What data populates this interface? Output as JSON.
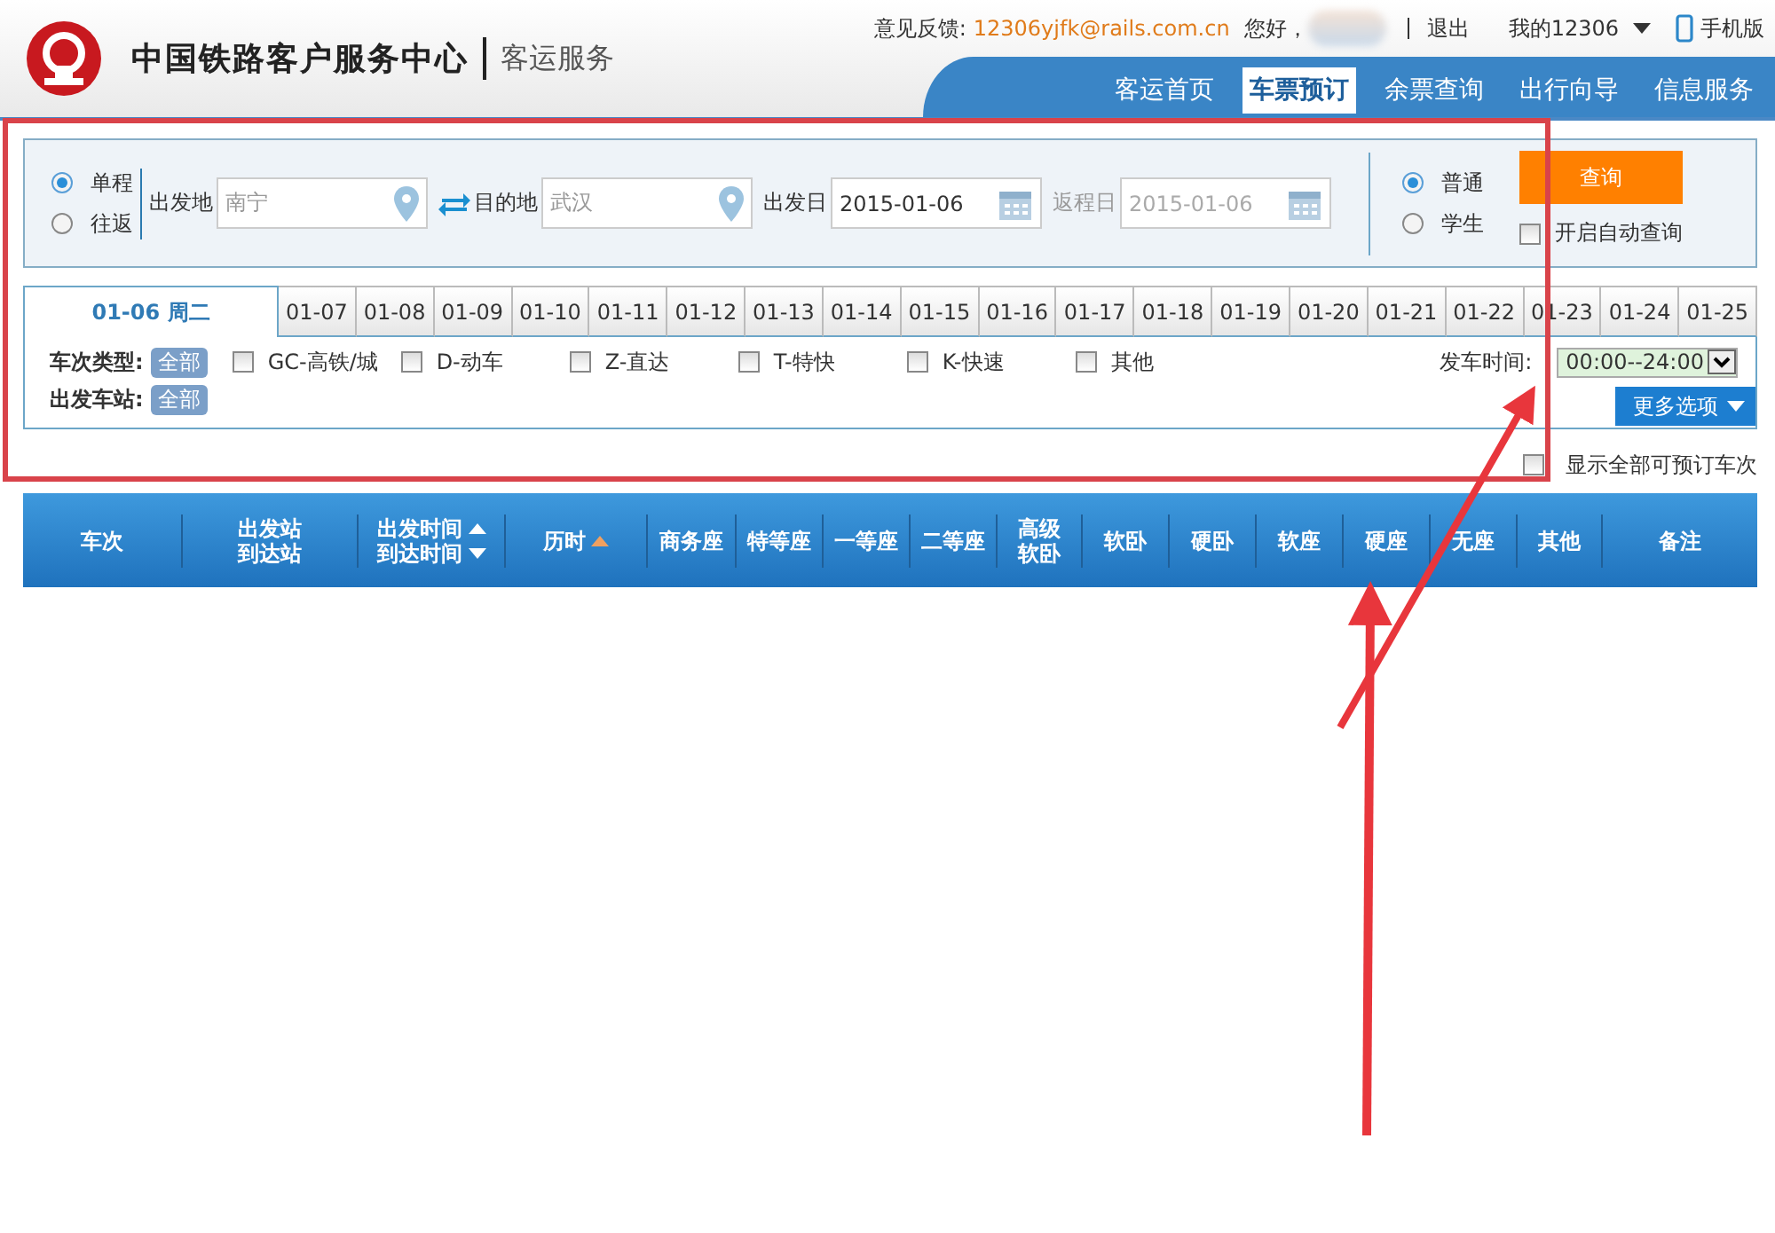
{
  "header": {
    "title": "中国铁路客户服务中心",
    "subtitle": "客运服务",
    "feedback_label": "意见反馈:",
    "feedback_email": "12306yjfk@rails.com.cn",
    "greeting": "您好，",
    "logout": "退出",
    "my_account": "我的12306",
    "mobile": "手机版"
  },
  "nav": [
    {
      "label": "客运首页",
      "selected": false
    },
    {
      "label": "车票预订",
      "selected": true
    },
    {
      "label": "余票查询",
      "selected": false
    },
    {
      "label": "出行向导",
      "selected": false
    },
    {
      "label": "信息服务",
      "selected": false
    }
  ],
  "search": {
    "trip_types": [
      {
        "label": "单程",
        "selected": true
      },
      {
        "label": "往返",
        "selected": false
      }
    ],
    "from": {
      "label": "出发地",
      "value": "南宁"
    },
    "to": {
      "label": "目的地",
      "value": "武汉"
    },
    "depart": {
      "label": "出发日",
      "value": "2015-01-06",
      "disabled": false
    },
    "return": {
      "label": "返程日",
      "value": "2015-01-06",
      "disabled": true
    },
    "passenger_types": [
      {
        "label": "普通",
        "selected": true
      },
      {
        "label": "学生",
        "selected": false
      }
    ],
    "query_button": "查询",
    "auto_query": {
      "label": "开启自动查询",
      "checked": false
    }
  },
  "dates": [
    {
      "label": "01-06 周二",
      "selected": true
    },
    {
      "label": "01-07",
      "selected": false
    },
    {
      "label": "01-08",
      "selected": false
    },
    {
      "label": "01-09",
      "selected": false
    },
    {
      "label": "01-10",
      "selected": false
    },
    {
      "label": "01-11",
      "selected": false
    },
    {
      "label": "01-12",
      "selected": false
    },
    {
      "label": "01-13",
      "selected": false
    },
    {
      "label": "01-14",
      "selected": false
    },
    {
      "label": "01-15",
      "selected": false
    },
    {
      "label": "01-16",
      "selected": false
    },
    {
      "label": "01-17",
      "selected": false
    },
    {
      "label": "01-18",
      "selected": false
    },
    {
      "label": "01-19",
      "selected": false
    },
    {
      "label": "01-20",
      "selected": false
    },
    {
      "label": "01-21",
      "selected": false
    },
    {
      "label": "01-22",
      "selected": false
    },
    {
      "label": "01-23",
      "selected": false
    },
    {
      "label": "01-24",
      "selected": false
    },
    {
      "label": "01-25",
      "selected": false
    }
  ],
  "filters": {
    "train_type_label": "车次类型:",
    "train_type_all": "全部",
    "train_types": [
      {
        "label": "GC-高铁/城",
        "checked": false
      },
      {
        "label": "D-动车",
        "checked": false
      },
      {
        "label": "Z-直达",
        "checked": false
      },
      {
        "label": "T-特快",
        "checked": false
      },
      {
        "label": "K-快速",
        "checked": false
      },
      {
        "label": "其他",
        "checked": false
      }
    ],
    "station_label": "出发车站:",
    "station_all": "全部",
    "time_label": "发车时间:",
    "time_value": "00:00--24:00",
    "more_button": "更多选项"
  },
  "show_all": {
    "label": "显示全部可预订车次",
    "checked": false
  },
  "table": {
    "columns": [
      {
        "lines": [
          "车次"
        ],
        "kind": "plain"
      },
      {
        "lines": [
          "出发站",
          "到达站"
        ],
        "kind": "plain"
      },
      {
        "lines": [
          "出发时间",
          "到达时间"
        ],
        "kind": "sort_pair"
      },
      {
        "lines": [
          "历时"
        ],
        "kind": "sort_active"
      },
      {
        "lines": [
          "商务座"
        ],
        "kind": "plain"
      },
      {
        "lines": [
          "特等座"
        ],
        "kind": "plain"
      },
      {
        "lines": [
          "一等座"
        ],
        "kind": "plain"
      },
      {
        "lines": [
          "二等座"
        ],
        "kind": "plain"
      },
      {
        "lines": [
          "高级",
          "软卧"
        ],
        "kind": "plain"
      },
      {
        "lines": [
          "软卧"
        ],
        "kind": "plain"
      },
      {
        "lines": [
          "硬卧"
        ],
        "kind": "plain"
      },
      {
        "lines": [
          "软座"
        ],
        "kind": "plain"
      },
      {
        "lines": [
          "硬座"
        ],
        "kind": "plain"
      },
      {
        "lines": [
          "无座"
        ],
        "kind": "plain"
      },
      {
        "lines": [
          "其他"
        ],
        "kind": "plain"
      },
      {
        "lines": [
          "备注"
        ],
        "kind": "plain"
      }
    ]
  }
}
